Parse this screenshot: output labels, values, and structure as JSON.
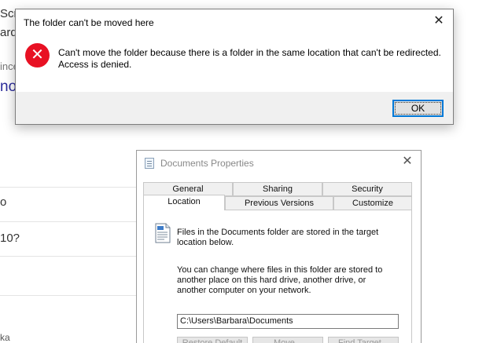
{
  "background": {
    "fragments": [
      "Scr",
      "ard",
      "ince",
      "not",
      "o",
      "10?",
      "ka"
    ]
  },
  "error_dialog": {
    "title": "The folder can't be moved here",
    "close_glyph": "✕",
    "icon_glyph": "✕",
    "message": "Can't move the folder because there is a folder in the same location that can't be redirected. Access is denied.",
    "ok_label": "OK",
    "accent_color": "#e81123",
    "focus_color": "#0078d7"
  },
  "properties_window": {
    "title": "Documents Properties",
    "close_glyph": "✕",
    "tabs_row1": [
      "General",
      "Sharing",
      "Security"
    ],
    "tabs_row2": [
      "Location",
      "Previous Versions",
      "Customize"
    ],
    "active_tab": "Location",
    "description": "Files in the Documents folder are stored in the target location below.",
    "instructions": "You can change where files in this folder are stored to another place on this hard drive, another drive, or another computer on your network.",
    "path_value": "C:\\Users\\Barbara\\Documents",
    "buttons": [
      "Restore Default",
      "Move...",
      "Find Target..."
    ]
  }
}
